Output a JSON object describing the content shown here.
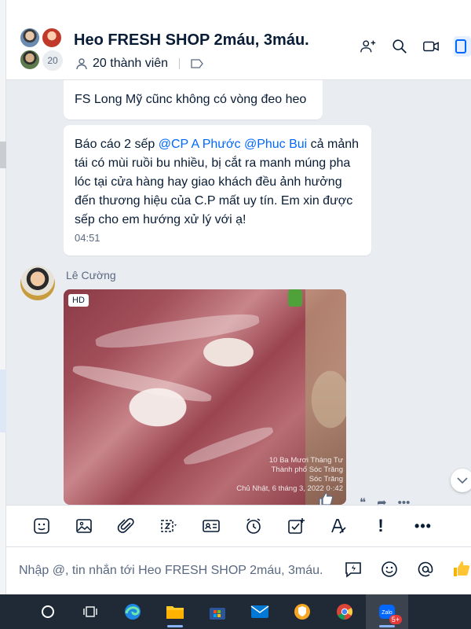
{
  "header": {
    "title": "Heo FRESH SHOP 2máu, 3máu.",
    "member_count_badge": "20",
    "members_label": "20 thành viên"
  },
  "messages": {
    "m1": "FS Long Mỹ cũnc không có vòng đeo heo",
    "m2_prefix": "Báo cáo 2 sếp ",
    "m2_mention1": "@CP A Phước",
    "m2_mention2": "@Phuc Bui",
    "m2_body": " cả mảnh tái có mùi ruồi bu nhiều, bị cắt ra manh múng pha lóc tại cửa hàng hay giao khách đều ảnh hưởng đến thương hiệu của C.P mất uy tín. Em xin được sếp cho em hướng xử lý với ạ!",
    "m2_time": "04:51",
    "sender_name": "Lê Cường",
    "photo_badge": "HD",
    "photo_stamp": [
      "10 Ba Mươi Tháng Tư",
      "Thành phố Sóc Trăng",
      "Sóc Trăng",
      "Chủ Nhật, 6 tháng 3, 2022 0·:42"
    ]
  },
  "input": {
    "placeholder": "Nhập @, tin nhắn tới Heo FRESH SHOP 2máu, 3máu."
  },
  "taskbar": {
    "zalo_badge": "5+"
  },
  "colors": {
    "accent": "#0068ff",
    "text": "#081c36",
    "muted": "#5a6981",
    "chat_bg": "#e9ecf1",
    "taskbar": "#202a36"
  },
  "icons": [
    "add-member-icon",
    "search-icon",
    "video-call-icon",
    "panel-toggle-icon",
    "sticker-icon",
    "image-icon",
    "attach-icon",
    "screenshot-icon",
    "contact-card-icon",
    "reminder-icon",
    "todo-icon",
    "format-text-icon",
    "urgent-icon",
    "more-icon",
    "quick-message-icon",
    "emoji-icon",
    "mention-icon",
    "like-icon"
  ]
}
